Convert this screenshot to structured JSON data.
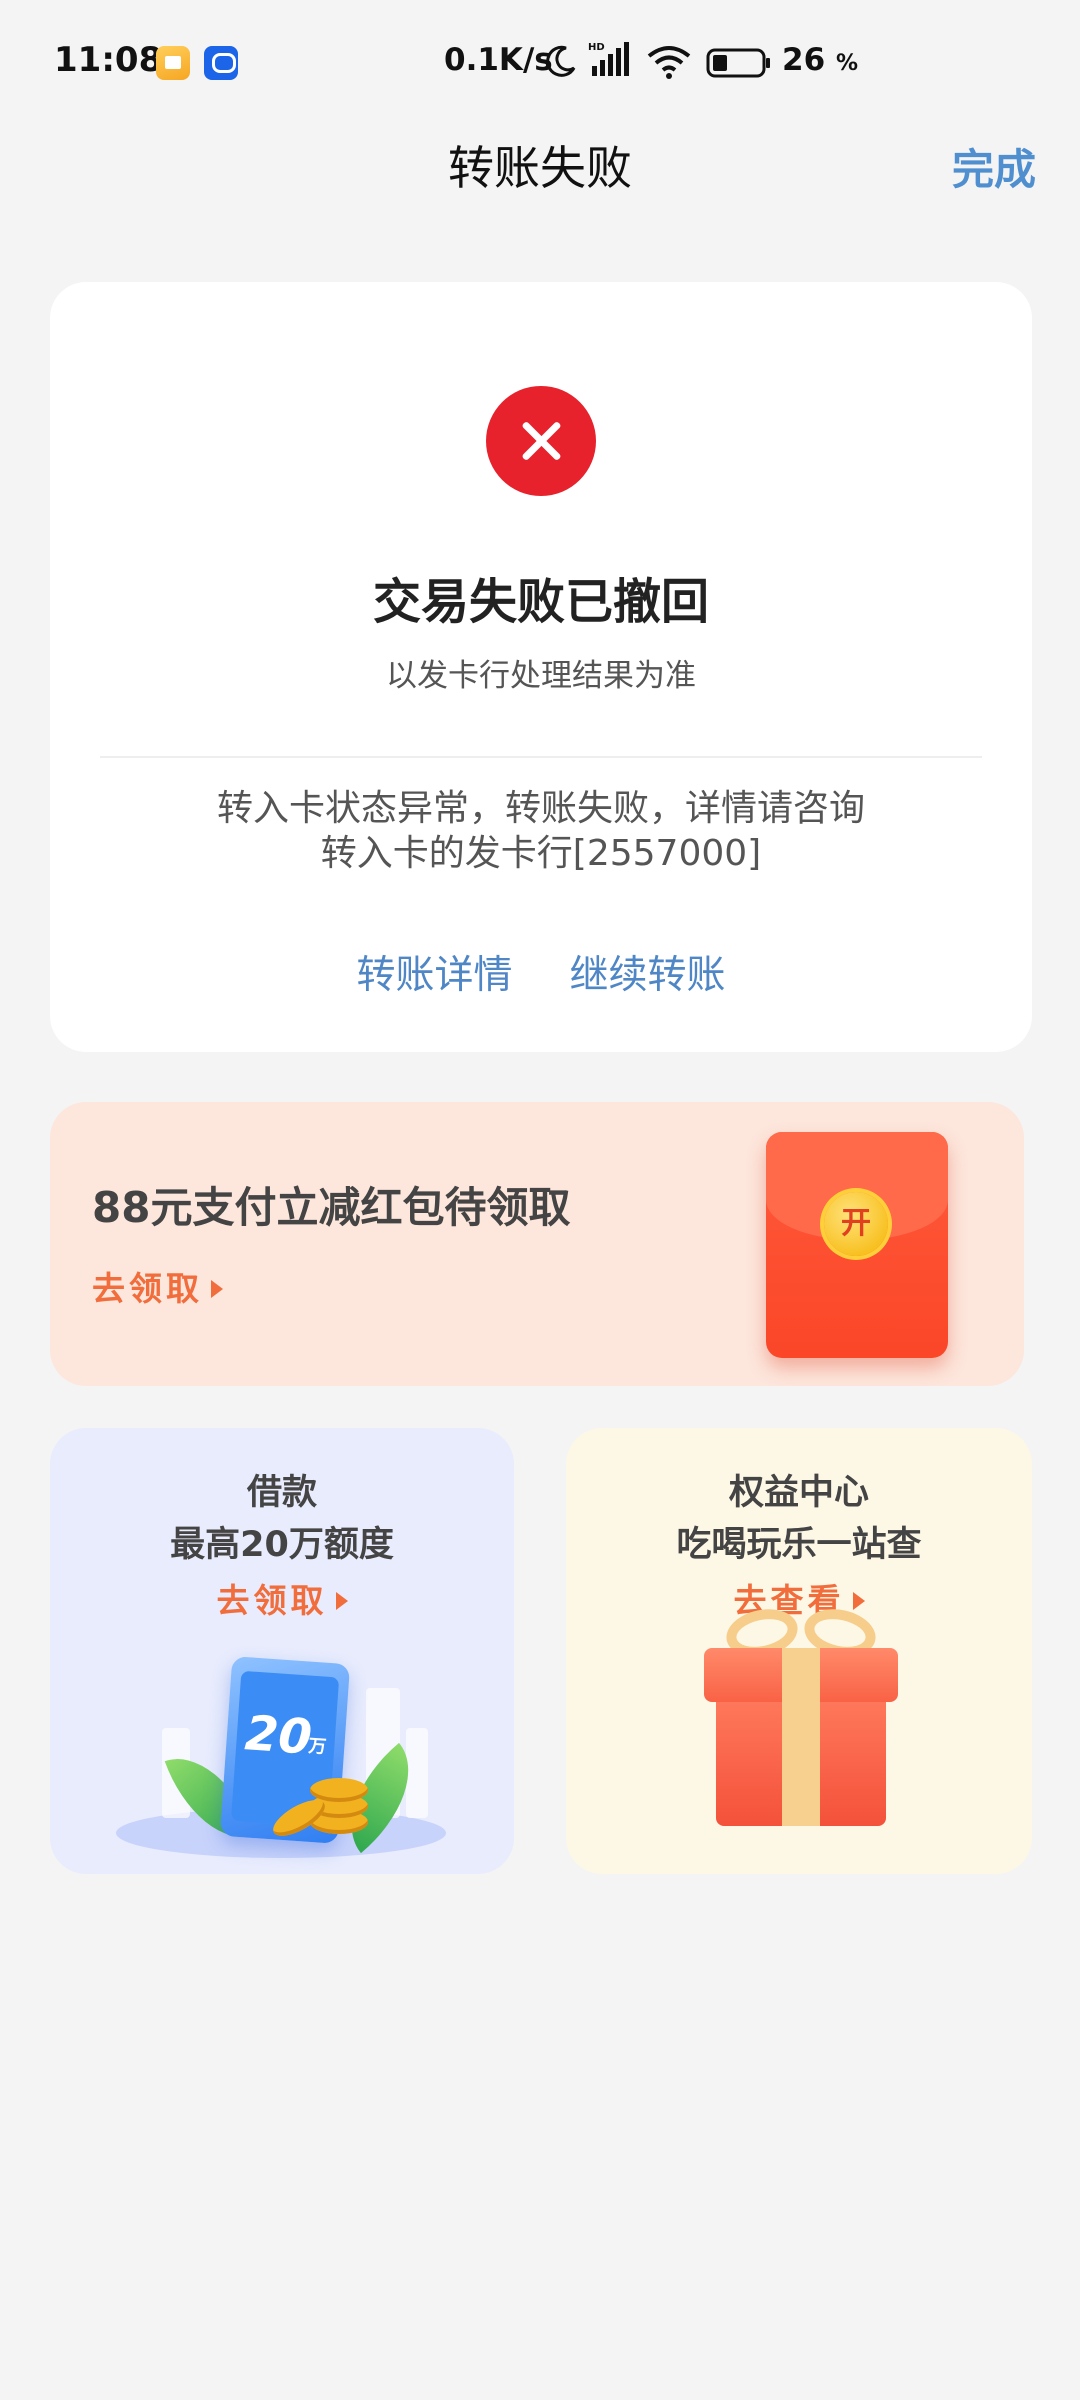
{
  "status_bar": {
    "time": "11:08",
    "network_speed": "0.1K/s",
    "battery_percent": "26",
    "battery_unit": "%",
    "icons": [
      "notes-app-icon",
      "alipay-app-icon",
      "moon-icon",
      "hd-signal-icon",
      "wifi-icon",
      "battery-icon"
    ]
  },
  "nav": {
    "title": "转账失败",
    "done_label": "完成"
  },
  "result": {
    "icon": "error-x-icon",
    "title": "交易失败已撤回",
    "subtitle": "以发卡行处理结果为准",
    "message_line1": "转入卡状态异常，转账失败，详情请咨询",
    "message_line2": "转入卡的发卡行[2557000]",
    "link_details": "转账详情",
    "link_continue": "继续转账"
  },
  "promo": {
    "title": "88元支付立减红包待领取",
    "cta": "去领取",
    "seal_char": "开"
  },
  "cards": {
    "loan": {
      "line1": "借款",
      "line2": "最高20万额度",
      "cta": "去领取",
      "amount": "20",
      "unit": "万"
    },
    "rights": {
      "line1": "权益中心",
      "line2": "吃喝玩乐一站查",
      "cta": "去查看"
    }
  },
  "colors": {
    "accent_link": "#4f86c6",
    "error_red": "#e8222c",
    "cta_orange": "#f16d3c",
    "promo_bg": "#fde6dc",
    "loan_bg": "#e8ecfd",
    "rights_bg": "#fdf7e6"
  }
}
